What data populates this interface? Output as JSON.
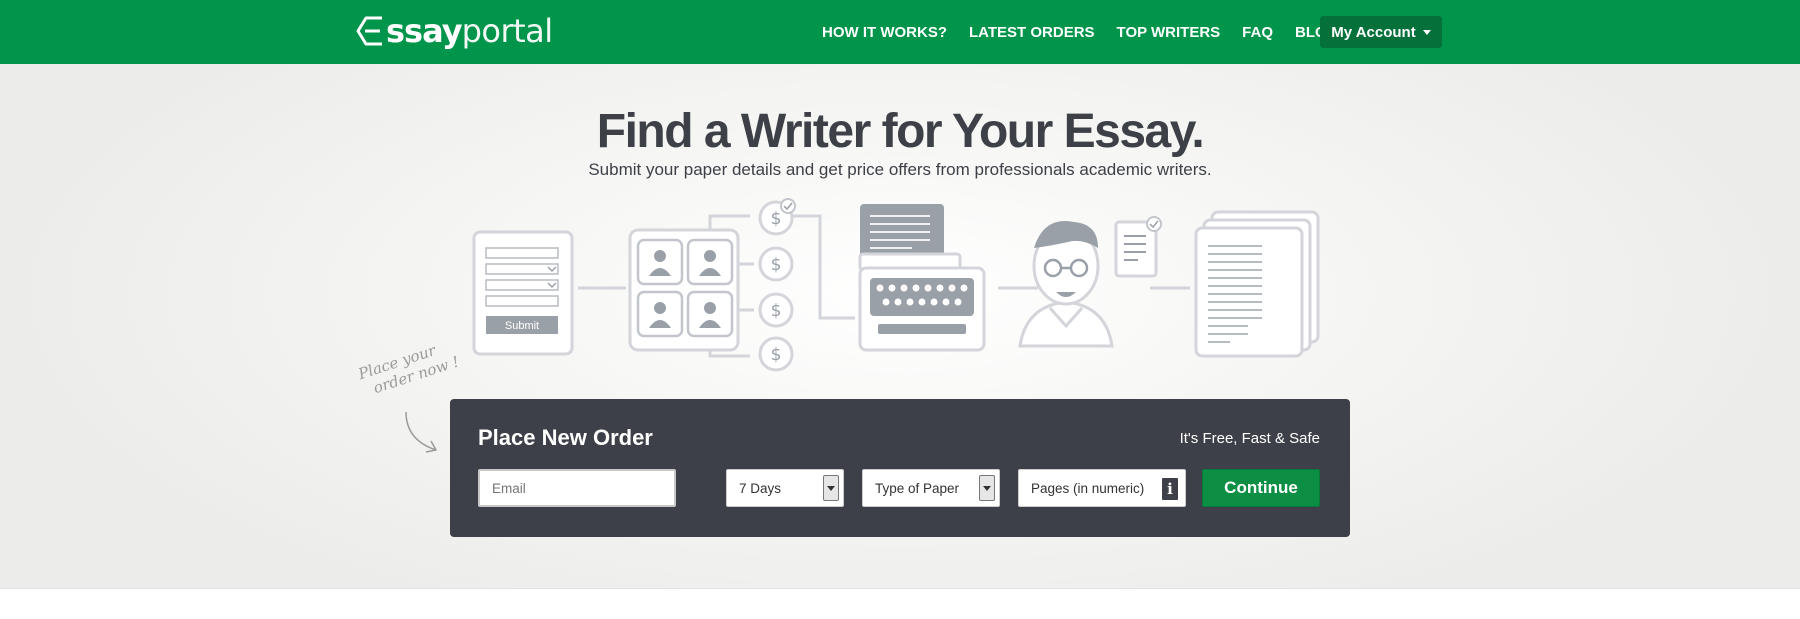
{
  "brand": {
    "logo_prefix": "ssay",
    "logo_suffix": "portal",
    "logo_full": "essayportal",
    "color_primary": "#00954a",
    "color_dark_panel": "#3d4048"
  },
  "nav": {
    "items": [
      {
        "label": "HOW IT WORKS?"
      },
      {
        "label": "LATEST ORDERS"
      },
      {
        "label": "TOP WRITERS"
      },
      {
        "label": "FAQ"
      },
      {
        "label": "BLOG"
      }
    ],
    "account_label": "My Account"
  },
  "hero": {
    "headline": "Find a Writer for Your Essay.",
    "subline": "Submit your paper details and get price offers from professionals academic writers.",
    "illustration": {
      "submit_label": "Submit",
      "currency_symbol": "$",
      "icons": [
        "order-form-icon",
        "writers-grid-icon",
        "price-offers-icon",
        "typewriter-icon",
        "writer-person-icon",
        "finished-paper-icon"
      ]
    },
    "note_line1": "Place your",
    "note_line2": "order now !"
  },
  "order": {
    "title": "Place New Order",
    "tagline": "It's Free, Fast & Safe",
    "email_placeholder": "Email",
    "email_value": "",
    "deadline_value": "7 Days",
    "paper_type_value": "Type of Paper",
    "pages_placeholder": "Pages (in numeric)",
    "continue_label": "Continue"
  }
}
